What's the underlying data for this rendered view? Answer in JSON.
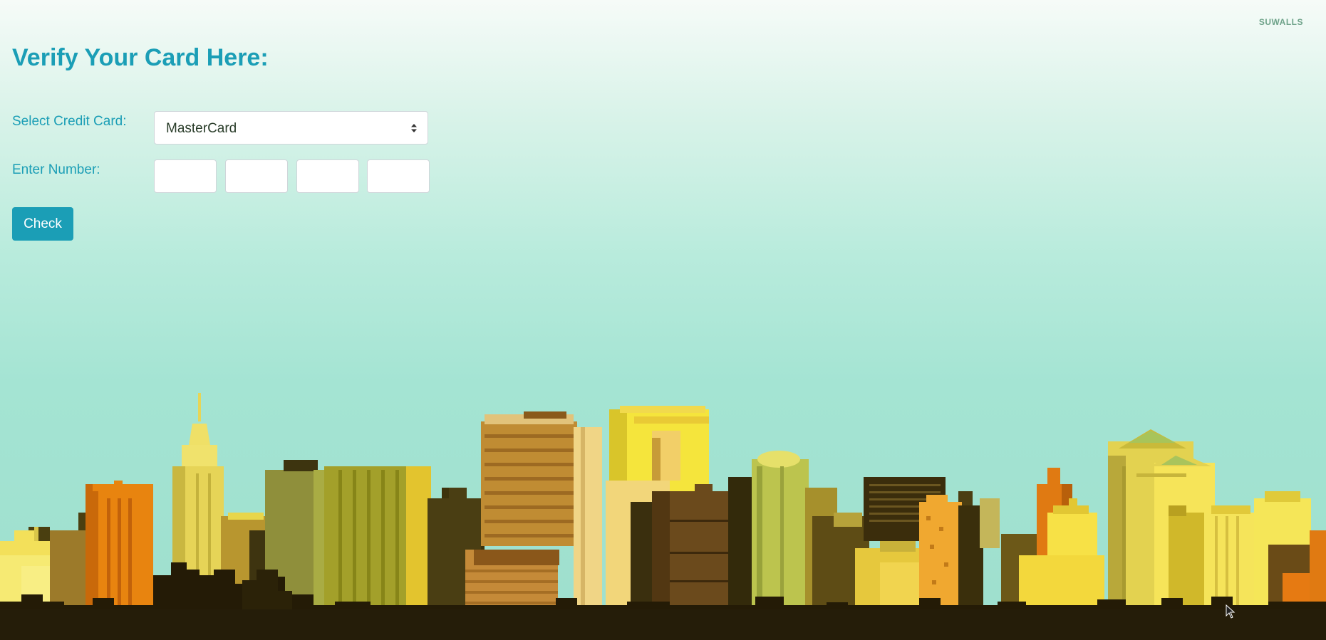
{
  "watermark": "SUWALLS",
  "form": {
    "title": "Verify Your Card Here:",
    "card_select": {
      "label": "Select Credit Card:",
      "value": "MasterCard"
    },
    "number": {
      "label": "Enter Number:",
      "fields": [
        "",
        "",
        "",
        ""
      ]
    },
    "check_button_label": "Check"
  },
  "colors": {
    "accent": "#1b9eb6",
    "sky_top": "#f6fbf8",
    "sky_bottom": "#9edfcd",
    "ground": "#251d09"
  }
}
